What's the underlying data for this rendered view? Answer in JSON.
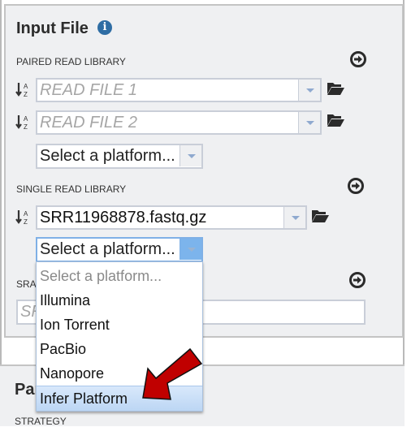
{
  "input_file": {
    "title": "Input File",
    "info_icon": "info-circle-icon",
    "paired": {
      "label": "PAIRED READ LIBRARY",
      "read_file_1_placeholder": "READ FILE 1",
      "read_file_2_placeholder": "READ FILE 2",
      "platform_select": "Select a platform..."
    },
    "single": {
      "label": "SINGLE READ LIBRARY",
      "file_value": "SRR11968878.fastq.gz",
      "platform_select": "Select a platform..."
    },
    "sra": {
      "label": "SRA",
      "placeholder": "SRR"
    }
  },
  "platform_dropdown": {
    "options": [
      "Select a platform...",
      "Illumina",
      "Ion Torrent",
      "PacBio",
      "Nanopore",
      "Infer Platform"
    ],
    "highlighted": "Infer Platform"
  },
  "next_section": {
    "title": "Parameters",
    "first_label": "STRATEGY"
  },
  "annotation": {
    "arrow_color": "#c00000",
    "points_to": "Infer Platform"
  }
}
